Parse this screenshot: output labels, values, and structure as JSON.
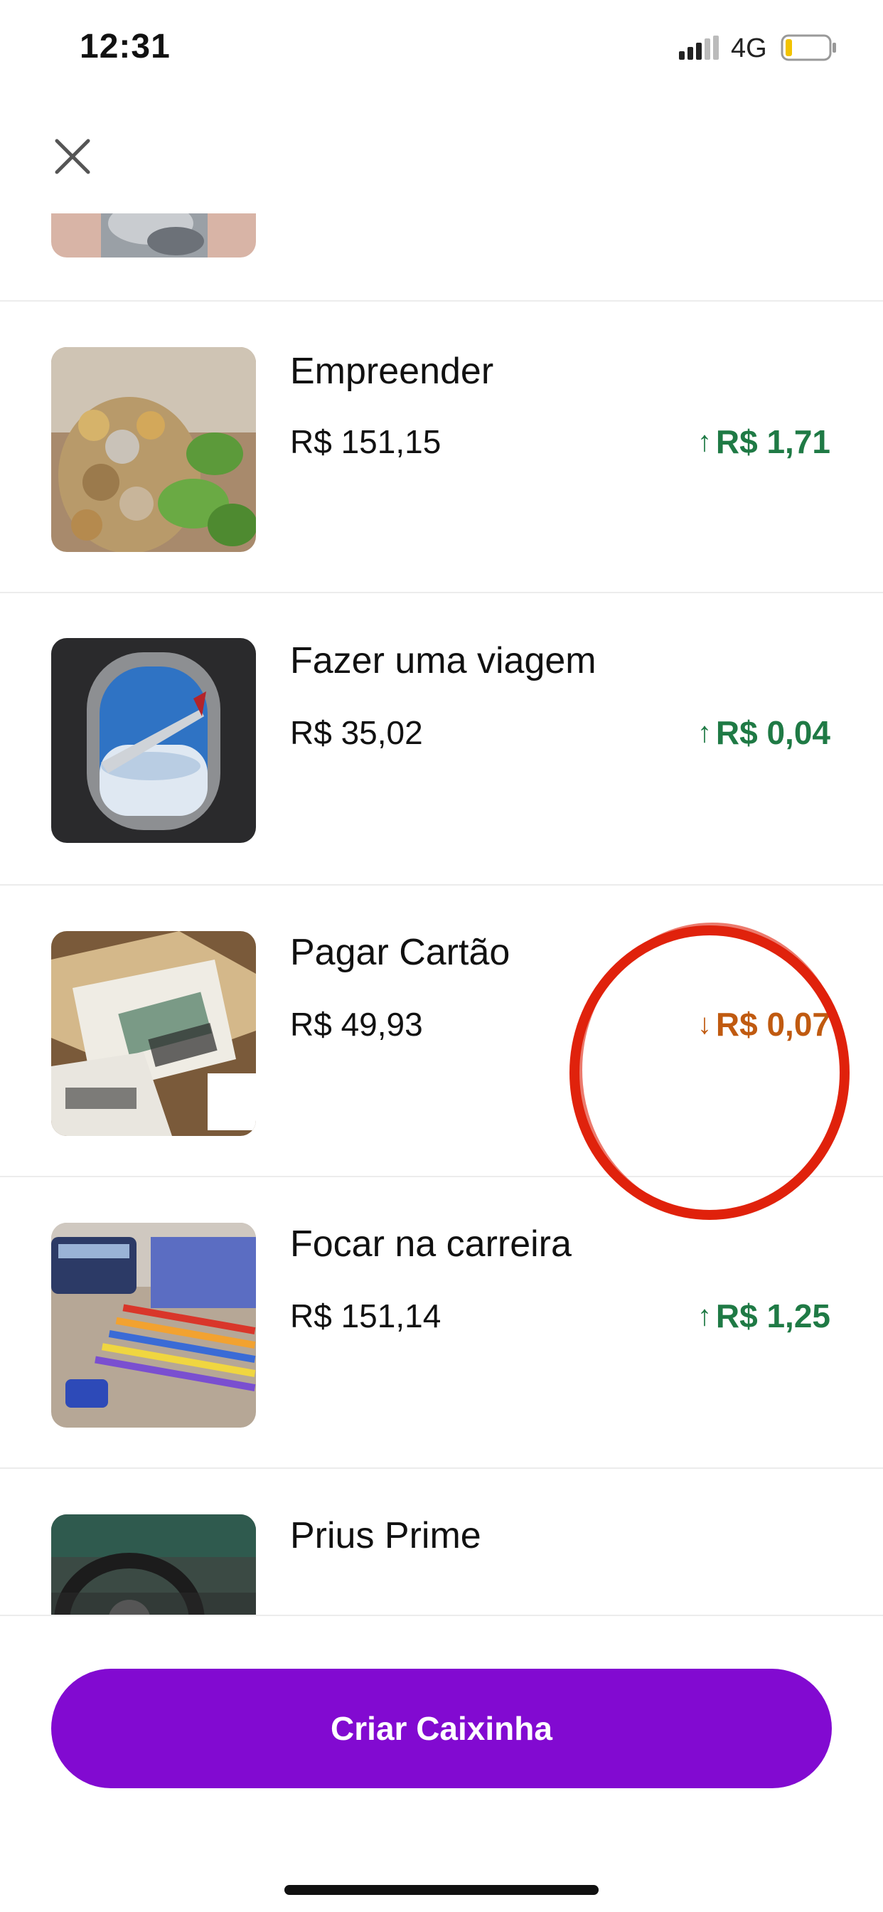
{
  "status_bar": {
    "time": "12:31",
    "network": "4G",
    "signal_icon": "signal-bars-icon",
    "battery_icon": "battery-low-icon",
    "battery_color": "#f2c300"
  },
  "header": {
    "close_icon": "close-icon"
  },
  "items": [
    {
      "name": "",
      "balance": "",
      "change": "",
      "direction": "up",
      "thumb": "coins-jar"
    },
    {
      "name": "Empreender",
      "balance": "R$ 151,15",
      "change": "R$ 1,71",
      "direction": "up",
      "thumb": "coins-plant"
    },
    {
      "name": "Fazer uma viagem",
      "balance": "R$ 35,02",
      "change": "R$ 0,04",
      "direction": "up",
      "thumb": "airplane-window"
    },
    {
      "name": "Pagar Cartão",
      "balance": "R$ 49,93",
      "change": "R$ 0,07",
      "direction": "down",
      "thumb": "bills-cards"
    },
    {
      "name": "Focar na carreira",
      "balance": "R$ 151,14",
      "change": "R$ 1,25",
      "direction": "up",
      "thumb": "stationery"
    },
    {
      "name": "Prius Prime",
      "balance": "",
      "change": "",
      "direction": "up",
      "thumb": "car-interior"
    }
  ],
  "colors": {
    "up": "#1f7a45",
    "down": "#c05a10",
    "primary": "#820ad1",
    "annotation": "#e0220c"
  },
  "actions": {
    "create_label": "Criar Caixinha"
  }
}
